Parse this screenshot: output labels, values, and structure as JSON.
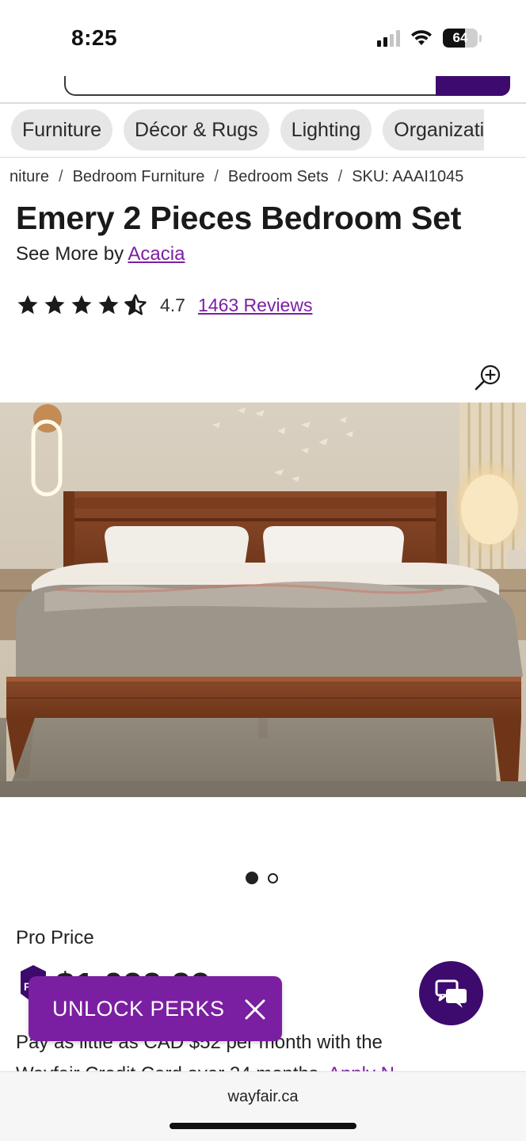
{
  "status_bar": {
    "time": "8:25",
    "battery_percent": "64",
    "battery_level": 0.64,
    "signal_bars_active": 2,
    "icons": [
      "signal-icon",
      "wifi-icon",
      "battery-icon"
    ]
  },
  "category_nav": {
    "chips": [
      "Furniture",
      "Décor & Rugs",
      "Lighting",
      "Organizati"
    ]
  },
  "breadcrumb": {
    "items": [
      "niture",
      "Bedroom Furniture",
      "Bedroom Sets",
      "SKU: AAAI1045"
    ],
    "separator": "/"
  },
  "product": {
    "title": "Emery 2 Pieces Bedroom Set",
    "see_more_prefix": "See More by",
    "brand": "Acacia",
    "rating_value": "4.7",
    "rating_stars": 4.7,
    "reviews_link": "1463 Reviews",
    "image_count": 2,
    "active_image": 1
  },
  "pricing": {
    "pro_price_label": "Pro Price",
    "price_partial": "$1,099.99",
    "financing_text": "Pay as little as CAD $52 per month with the",
    "financing_text_line2": "Wayfair Credit Card over 24 months.",
    "financing_link": "Apply N"
  },
  "promo": {
    "unlock_perks_label": "UNLOCK PERKS"
  },
  "browser": {
    "url": "wayfair.ca"
  },
  "colors": {
    "brand_purple": "#7b1fa2",
    "dark_purple": "#3d0a6e"
  }
}
